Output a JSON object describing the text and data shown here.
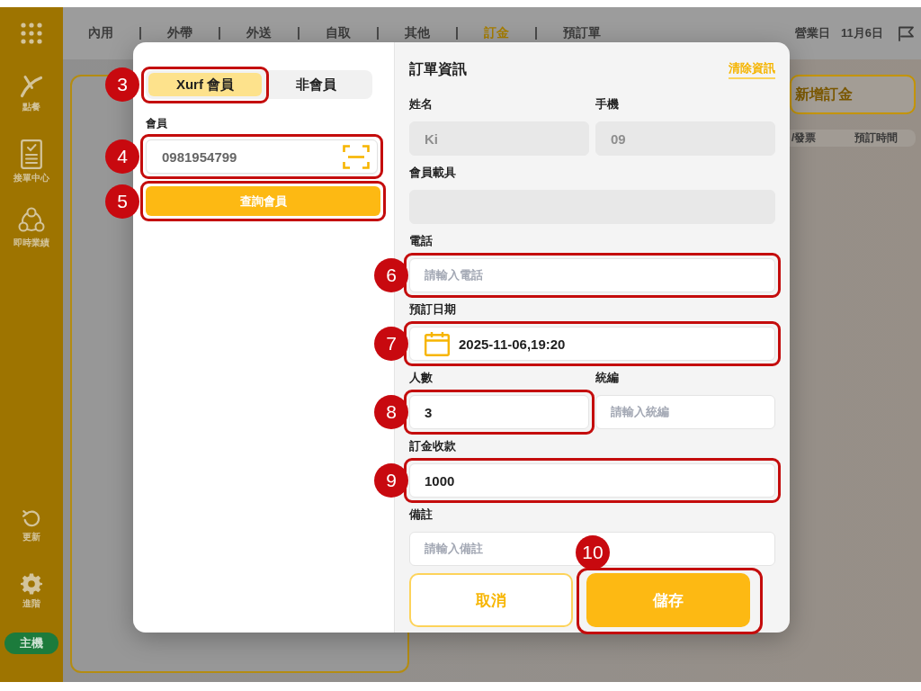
{
  "sidebar": {
    "top_items": [
      {
        "label": "點餐"
      },
      {
        "label": "接單中心"
      },
      {
        "label": "即時業績"
      }
    ],
    "bottom_items": [
      {
        "label": "更新"
      },
      {
        "label": "進階"
      }
    ],
    "host_badge": "主機"
  },
  "top_bar": {
    "tabs": [
      {
        "label": "內用",
        "selected": false
      },
      {
        "label": "外帶",
        "selected": false
      },
      {
        "label": "外送",
        "selected": false
      },
      {
        "label": "自取",
        "selected": false
      },
      {
        "label": "其他",
        "selected": false
      },
      {
        "label": "訂金",
        "selected": true
      },
      {
        "label": "預訂單",
        "selected": false
      }
    ],
    "business_day_label": "營業日",
    "business_day": "11月6日"
  },
  "deposit_panel": {
    "add_button": "新增訂金",
    "table_columns": [
      "/發票",
      "預訂時間"
    ]
  },
  "dialog": {
    "member_toggle": [
      {
        "label": "Xurf 會員",
        "selected": true,
        "callout": "3"
      },
      {
        "label": "非會員",
        "selected": false
      }
    ],
    "member_field": {
      "label": "會員",
      "value": "0981954799",
      "callout": "4"
    },
    "query_button": {
      "label": "查詢會員",
      "callout": "5"
    },
    "title": "訂單資訊",
    "clear_link": "清除資訊",
    "rows": [
      {
        "fields": [
          {
            "kind": "text",
            "label": "姓名",
            "value": "Ki",
            "disabled": true
          },
          {
            "kind": "text",
            "label": "手機",
            "value": "09",
            "disabled": true
          }
        ]
      },
      {
        "fields": [
          {
            "kind": "text",
            "label": "會員載具",
            "disabled": true
          }
        ]
      },
      {
        "fields": [
          {
            "kind": "text",
            "label": "電話",
            "placeholder": "請輸入電話",
            "disabled": false,
            "callout": "6"
          }
        ]
      },
      {
        "fields": [
          {
            "kind": "date",
            "label": "預訂日期",
            "value": "2025-11-06,19:20",
            "disabled": false,
            "callout": "7"
          }
        ]
      },
      {
        "fields": [
          {
            "kind": "text",
            "label": "人數",
            "value": "3",
            "disabled": false,
            "callout": "8"
          },
          {
            "kind": "text",
            "label": "統編",
            "placeholder": "請輸入統編",
            "disabled": false
          }
        ]
      },
      {
        "fields": [
          {
            "kind": "text",
            "label": "訂金收款",
            "value": "1000",
            "disabled": false,
            "callout": "9"
          }
        ]
      },
      {
        "fields": [
          {
            "kind": "text",
            "label": "備註",
            "placeholder": "請輸入備註",
            "disabled": false
          }
        ]
      }
    ],
    "buttons": [
      {
        "kind": "secondary",
        "label": "取消"
      },
      {
        "kind": "primary",
        "label": "儲存",
        "callout": "10"
      }
    ]
  }
}
